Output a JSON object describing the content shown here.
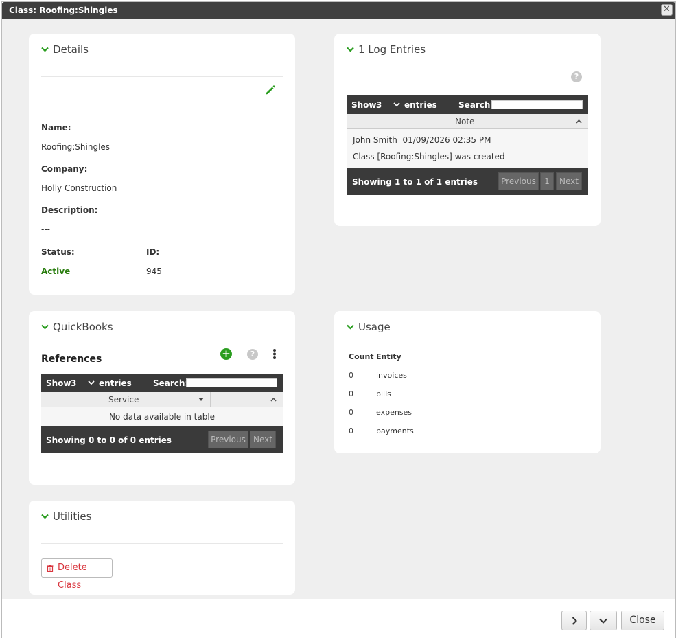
{
  "window": {
    "title": "Class: Roofing:Shingles"
  },
  "details": {
    "title": "Details",
    "name_label": "Name:",
    "name_value": "Roofing:Shingles",
    "company_label": "Company:",
    "company_value": "Holly Construction",
    "description_label": "Description:",
    "description_value": "---",
    "status_label": "Status:",
    "status_value": "Active",
    "id_label": "ID:",
    "id_value": "945"
  },
  "log": {
    "title": "1 Log Entries",
    "show_label": "Show",
    "show_value": "3",
    "entries_label": "entries",
    "search_label": "Search:",
    "column": "Note",
    "rows": [
      {
        "meta": "John Smith  01/09/2026 02:35 PM",
        "text": "Class [Roofing:Shingles] was created"
      }
    ],
    "info": "Showing 1 to 1 of 1 entries",
    "prev": "Previous",
    "page": "1",
    "next": "Next"
  },
  "quickbooks": {
    "title": "QuickBooks",
    "subtitle": "References",
    "show_label": "Show",
    "show_value": "3",
    "entries_label": "entries",
    "search_label": "Search:",
    "column": "Service",
    "empty": "No data available in table",
    "info": "Showing 0 to 0 of 0 entries",
    "prev": "Previous",
    "next": "Next"
  },
  "usage": {
    "title": "Usage",
    "col_count": "Count",
    "col_entity": "Entity",
    "rows": [
      {
        "count": "0",
        "entity": "invoices"
      },
      {
        "count": "0",
        "entity": "bills"
      },
      {
        "count": "0",
        "entity": "expenses"
      },
      {
        "count": "0",
        "entity": "payments"
      }
    ]
  },
  "utilities": {
    "title": "Utilities",
    "delete_label": "Delete Class"
  },
  "footer": {
    "next_icon": "chevron-right-icon",
    "down_icon": "chevron-down-icon",
    "close_label": "Close"
  },
  "colors": {
    "accent_green": "#2a9d1f",
    "dark_bar": "#3a3a3a",
    "danger": "#d9363e"
  }
}
